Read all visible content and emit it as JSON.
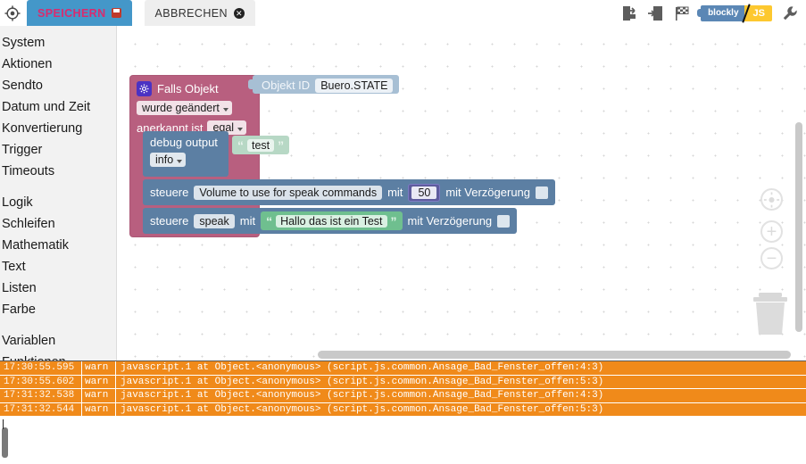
{
  "topbar": {
    "target_icon": "target-icon",
    "tabs": [
      {
        "label": "SPEICHERN",
        "badge": "save-disk-icon"
      },
      {
        "label": "ABBRECHEN",
        "badge": "close-circle-icon"
      }
    ],
    "tools": [
      {
        "name": "export-icon"
      },
      {
        "name": "import-icon"
      },
      {
        "name": "checkered-flag-icon"
      },
      {
        "name": "wrench-icon"
      }
    ],
    "lang_toggle": {
      "left": "blockly",
      "right": "JS"
    }
  },
  "sidebar": {
    "groups": [
      {
        "items": [
          "System",
          "Aktionen",
          "Sendto",
          "Datum und Zeit",
          "Konvertierung",
          "Trigger",
          "Timeouts"
        ]
      },
      {
        "items": [
          "Logik",
          "Schleifen",
          "Mathematik",
          "Text",
          "Listen",
          "Farbe"
        ]
      },
      {
        "items": [
          "Variablen",
          "Funktionen"
        ]
      }
    ]
  },
  "workspace": {
    "trigger": {
      "title": "Falls Objekt",
      "condition_dropdown": "wurde geändert",
      "ack_label": "anerkannt ist",
      "ack_dropdown": "egal"
    },
    "object_id": {
      "label": "Objekt ID",
      "value": "Buero.STATE"
    },
    "debug": {
      "label": "debug output",
      "level_dropdown": "info",
      "text_value": "test"
    },
    "control_volume": {
      "verb": "steuere",
      "target": "Volume to use for speak commands",
      "with": "mit",
      "value": "50",
      "delay_label": "mit Verzögerung"
    },
    "control_speak": {
      "verb": "steuere",
      "target": "speak",
      "with": "mit",
      "text_value": "Hallo das ist ein Test",
      "delay_label": "mit Verzögerung"
    },
    "zoom_controls": [
      {
        "name": "zoom-reset-icon"
      },
      {
        "name": "zoom-in-icon",
        "glyph": "+"
      },
      {
        "name": "zoom-out-icon",
        "glyph": "−"
      }
    ],
    "trash_icon": "trash-icon"
  },
  "log": {
    "rows": [
      {
        "time": "17:30:55.595",
        "severity": "warn",
        "message": "javascript.1 at Object.<anonymous> (script.js.common.Ansage_Bad_Fenster_offen:4:3)"
      },
      {
        "time": "17:30:55.602",
        "severity": "warn",
        "message": "javascript.1 at Object.<anonymous> (script.js.common.Ansage_Bad_Fenster_offen:5:3)"
      },
      {
        "time": "17:31:32.538",
        "severity": "warn",
        "message": "javascript.1 at Object.<anonymous> (script.js.common.Ansage_Bad_Fenster_offen:4:3)"
      },
      {
        "time": "17:31:32.544",
        "severity": "warn",
        "message": "javascript.1 at Object.<anonymous> (script.js.common.Ansage_Bad_Fenster_offen:5:3)"
      }
    ]
  },
  "colors": {
    "save_tab_bg": "#4497c9",
    "save_tab_text": "#d92b6e",
    "trigger_block": "#b85f7f",
    "control_block": "#5c7fa3",
    "text_block": "#6fbf8f",
    "number_block": "#5e5c9e",
    "object_block": "#a7bfd4",
    "log_warn": "#f08a1a"
  }
}
